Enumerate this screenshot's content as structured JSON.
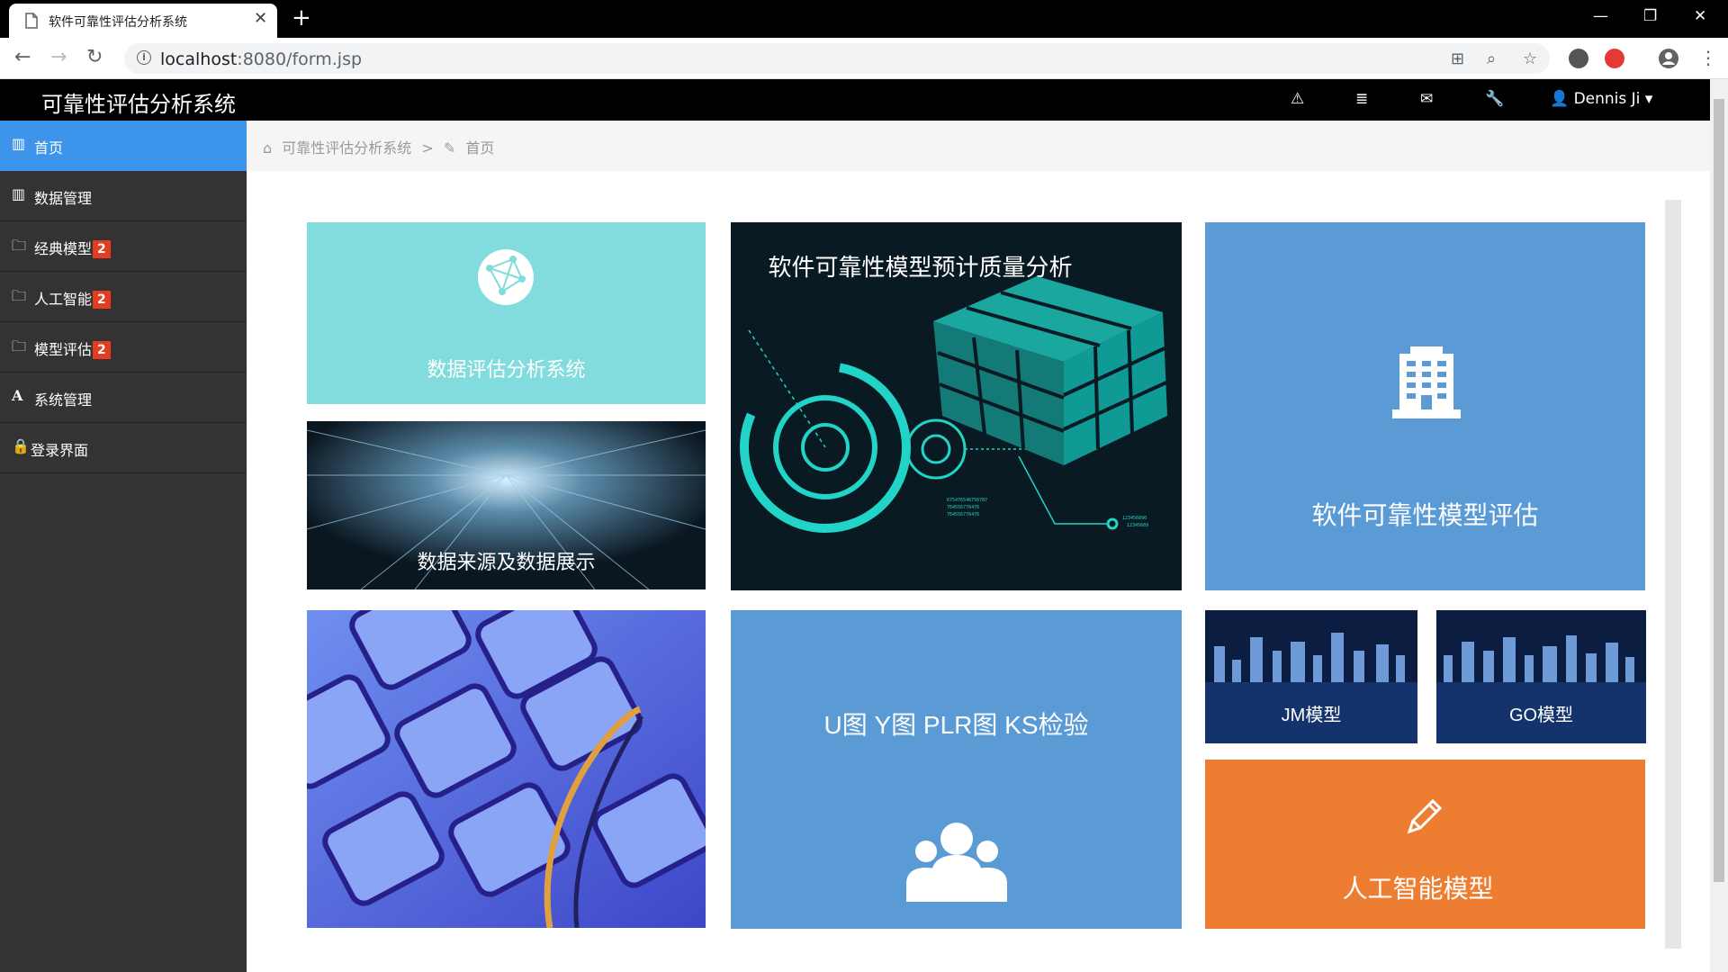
{
  "browser": {
    "tab_title": "软件可靠性评估分析系统",
    "url_host": "localhost",
    "url_path": ":8080/form.jsp",
    "new_tab_symbol": "+",
    "close_symbol": "✕"
  },
  "app": {
    "brand": "可靠性评估分析系统",
    "user_name": "Dennis Ji",
    "top_icons": [
      "warning-icon",
      "tasks-icon",
      "envelope-icon",
      "wrench-icon"
    ]
  },
  "sidebar": {
    "items": [
      {
        "label": "首页",
        "icon": "bar-chart-icon",
        "active": true
      },
      {
        "label": "数据管理",
        "icon": "bar-chart-icon"
      },
      {
        "label": "经典模型",
        "icon": "folder-icon",
        "badge": "2"
      },
      {
        "label": "人工智能",
        "icon": "folder-icon",
        "badge": "2"
      },
      {
        "label": "模型评估",
        "icon": "folder-icon",
        "badge": "2"
      },
      {
        "label": "系统管理",
        "icon": "font-icon"
      },
      {
        "label": "登录界面",
        "icon": "lock-icon"
      }
    ]
  },
  "breadcrumb": {
    "root": "可靠性评估分析系统",
    "separator": ">",
    "current": "首页"
  },
  "tiles": {
    "data_eval": "数据评估分析系统",
    "quality_analysis": "软件可靠性模型预计质量分析",
    "model_eval": "软件可靠性模型评估",
    "data_source": "数据来源及数据展示",
    "tests": "U图 Y图 PLR图 KS检验",
    "jm_model": "JM模型",
    "go_model": "GO模型",
    "ai_model": "人工智能模型"
  },
  "colors": {
    "accent": "#3c95ea",
    "teal_tile": "#82dbdc",
    "blue_tile": "#5b9bd5",
    "orange_tile": "#ed7d31",
    "badge": "#e43c1e"
  }
}
